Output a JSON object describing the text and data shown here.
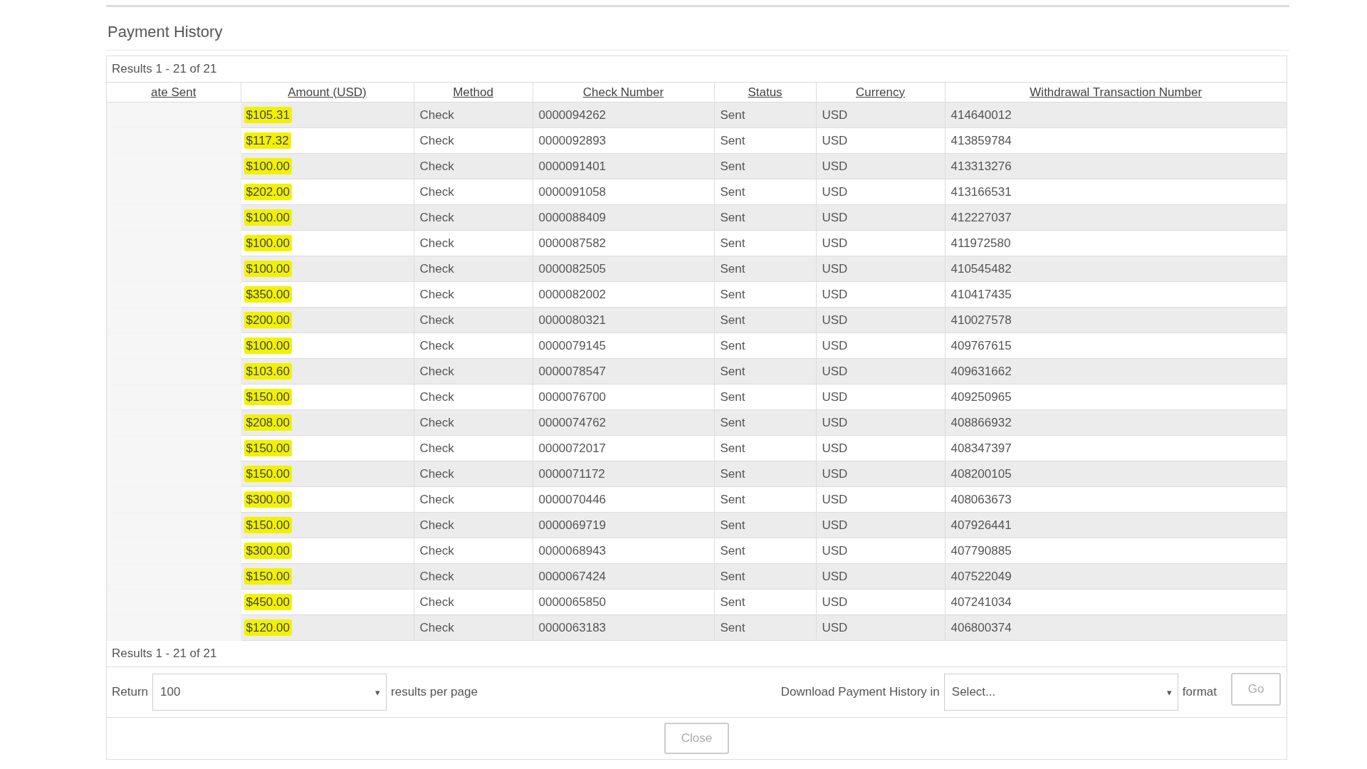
{
  "title": "Payment History",
  "results_top": "Results 1 - 21 of 21",
  "table": {
    "columns": [
      "ate Sent",
      "Amount (USD)",
      "Method",
      "Check Number",
      "Status",
      "Currency",
      "Withdrawal Transaction Number"
    ],
    "rows": [
      {
        "amount": "$105.31",
        "highlighted": true,
        "method": "Check",
        "check_number": "0000094262",
        "status": "Sent",
        "currency": "USD",
        "withdrawal": "414640012"
      },
      {
        "amount": "$117.32",
        "highlighted": true,
        "method": "Check",
        "check_number": "0000092893",
        "status": "Sent",
        "currency": "USD",
        "withdrawal": "413859784"
      },
      {
        "amount": "$100.00",
        "highlighted": true,
        "method": "Check",
        "check_number": "0000091401",
        "status": "Sent",
        "currency": "USD",
        "withdrawal": "413313276"
      },
      {
        "amount": "$202.00",
        "highlighted": true,
        "method": "Check",
        "check_number": "0000091058",
        "status": "Sent",
        "currency": "USD",
        "withdrawal": "413166531"
      },
      {
        "amount": "$100.00",
        "highlighted": true,
        "method": "Check",
        "check_number": "0000088409",
        "status": "Sent",
        "currency": "USD",
        "withdrawal": "412227037"
      },
      {
        "amount": "$100.00",
        "highlighted": true,
        "method": "Check",
        "check_number": "0000087582",
        "status": "Sent",
        "currency": "USD",
        "withdrawal": "411972580"
      },
      {
        "amount": "$100.00",
        "highlighted": true,
        "method": "Check",
        "check_number": "0000082505",
        "status": "Sent",
        "currency": "USD",
        "withdrawal": "410545482"
      },
      {
        "amount": "$350.00",
        "highlighted": true,
        "method": "Check",
        "check_number": "0000082002",
        "status": "Sent",
        "currency": "USD",
        "withdrawal": "410417435"
      },
      {
        "amount": "$200.00",
        "highlighted": true,
        "method": "Check",
        "check_number": "0000080321",
        "status": "Sent",
        "currency": "USD",
        "withdrawal": "410027578"
      },
      {
        "amount": "$100.00",
        "highlighted": true,
        "method": "Check",
        "check_number": "0000079145",
        "status": "Sent",
        "currency": "USD",
        "withdrawal": "409767615"
      },
      {
        "amount": "$103.60",
        "highlighted": true,
        "method": "Check",
        "check_number": "0000078547",
        "status": "Sent",
        "currency": "USD",
        "withdrawal": "409631662"
      },
      {
        "amount": "$150.00",
        "highlighted": true,
        "method": "Check",
        "check_number": "0000076700",
        "status": "Sent",
        "currency": "USD",
        "withdrawal": "409250965"
      },
      {
        "amount": "$208.00",
        "highlighted": true,
        "method": "Check",
        "check_number": "0000074762",
        "status": "Sent",
        "currency": "USD",
        "withdrawal": "408866932"
      },
      {
        "amount": "$150.00",
        "highlighted": true,
        "method": "Check",
        "check_number": "0000072017",
        "status": "Sent",
        "currency": "USD",
        "withdrawal": "408347397"
      },
      {
        "amount": "$150.00",
        "highlighted": true,
        "method": "Check",
        "check_number": "0000071172",
        "status": "Sent",
        "currency": "USD",
        "withdrawal": "408200105"
      },
      {
        "amount": "$300.00",
        "highlighted": true,
        "method": "Check",
        "check_number": "0000070446",
        "status": "Sent",
        "currency": "USD",
        "withdrawal": "408063673"
      },
      {
        "amount": "$150.00",
        "highlighted": true,
        "method": "Check",
        "check_number": "0000069719",
        "status": "Sent",
        "currency": "USD",
        "withdrawal": "407926441"
      },
      {
        "amount": "$300.00",
        "highlighted": true,
        "method": "Check",
        "check_number": "0000068943",
        "status": "Sent",
        "currency": "USD",
        "withdrawal": "407790885"
      },
      {
        "amount": "$150.00",
        "highlighted": true,
        "method": "Check",
        "check_number": "0000067424",
        "status": "Sent",
        "currency": "USD",
        "withdrawal": "407522049"
      },
      {
        "amount": "$450.00",
        "highlighted": true,
        "method": "Check",
        "check_number": "0000065850",
        "status": "Sent",
        "currency": "USD",
        "withdrawal": "407241034"
      },
      {
        "amount": "$120.00",
        "highlighted": true,
        "method": "Check",
        "check_number": "0000063183",
        "status": "Sent",
        "currency": "USD",
        "withdrawal": "406800374"
      }
    ]
  },
  "results_bottom": "Results 1 - 21 of 21",
  "return_label": "Return",
  "per_page": {
    "value": "100",
    "caret": "▾"
  },
  "per_page_label": "results per page",
  "download_label": "Download Payment History in",
  "format_select": {
    "value": "Select...",
    "caret": "▾"
  },
  "format_label": "format",
  "go_button": "Go",
  "close_button": "Close"
}
